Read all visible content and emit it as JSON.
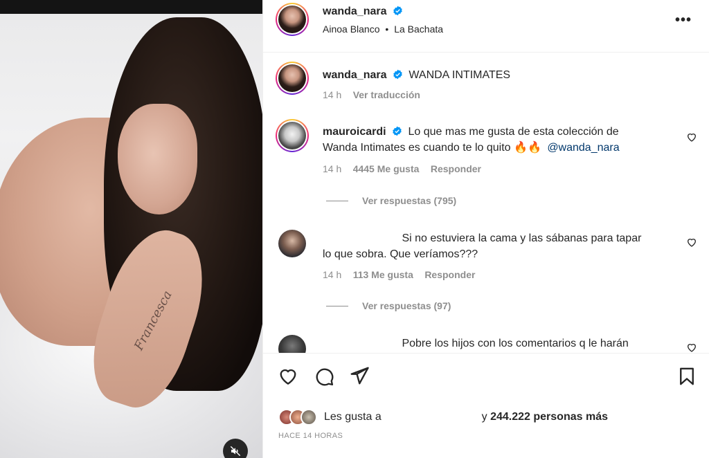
{
  "media": {
    "tattoo_text": "Francesca",
    "mute_icon": "speaker-muted-icon"
  },
  "header": {
    "username": "wanda_nara",
    "audio_artist": "Ainoa Blanco",
    "separator": "•",
    "audio_title": "La Bachata",
    "more_icon": "•••"
  },
  "caption": {
    "username": "wanda_nara",
    "text": "WANDA INTIMATES",
    "time": "14 h",
    "translate": "Ver traducción"
  },
  "comments": [
    {
      "username": "mauroicardi",
      "text": "Lo que mas me gusta de esta colección de",
      "text_line2": "Wanda Intimates es cuando te lo quito 🔥🔥",
      "mention": "@wanda_nara",
      "time": "14 h",
      "likes": "4445 Me gusta",
      "reply": "Responder",
      "view_replies": "Ver respuestas (795)"
    },
    {
      "username": "",
      "text": "Si no estuviera la cama y las sábanas para tapar",
      "text_line2": "lo que sobra. Que veríamos???",
      "time": "14 h",
      "likes": "113 Me gusta",
      "reply": "Responder",
      "view_replies": "Ver respuestas (97)"
    },
    {
      "username": "",
      "text": "Pobre los hijos con los comentarios q le harán"
    }
  ],
  "likes": {
    "prefix": "Les gusta a",
    "suffix": "y",
    "count": "244.222 personas más"
  },
  "posted": "HACE 14 HORAS",
  "colors": {
    "verified": "#0095f6",
    "text": "#262626",
    "secondary": "#8e8e8e",
    "mention": "#00376b"
  }
}
